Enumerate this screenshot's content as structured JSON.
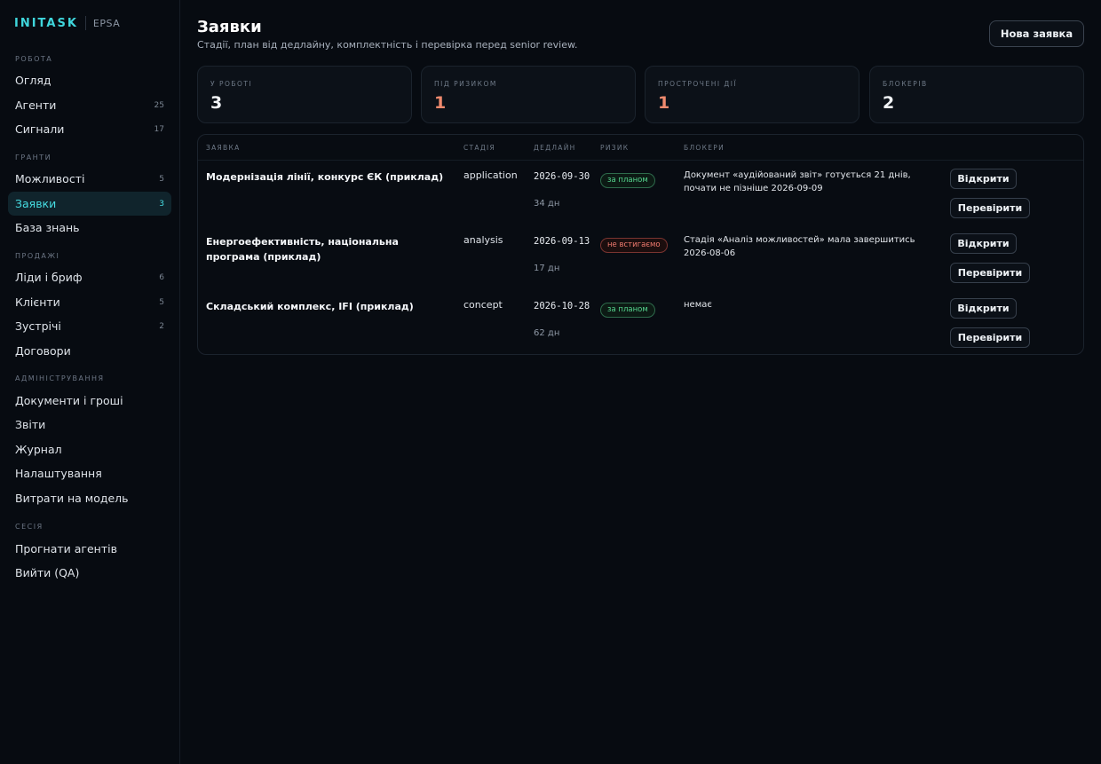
{
  "brand": {
    "logo": "INITASK",
    "sub": "EPSA"
  },
  "sidebar": {
    "sections": [
      {
        "title": "РОБОТА",
        "items": [
          {
            "label": "Огляд",
            "count": ""
          },
          {
            "label": "Агенти",
            "count": "25"
          },
          {
            "label": "Сигнали",
            "count": "17"
          }
        ]
      },
      {
        "title": "ГРАНТИ",
        "items": [
          {
            "label": "Можливості",
            "count": "5"
          },
          {
            "label": "Заявки",
            "count": "3",
            "active": true
          },
          {
            "label": "База знань",
            "count": ""
          }
        ]
      },
      {
        "title": "ПРОДАЖІ",
        "items": [
          {
            "label": "Ліди і бриф",
            "count": "6"
          },
          {
            "label": "Клієнти",
            "count": "5"
          },
          {
            "label": "Зустрічі",
            "count": "2"
          },
          {
            "label": "Договори",
            "count": ""
          }
        ]
      },
      {
        "title": "АДМІНІСТРУВАННЯ",
        "items": [
          {
            "label": "Документи і гроші",
            "count": ""
          },
          {
            "label": "Звіти",
            "count": ""
          },
          {
            "label": "Журнал",
            "count": ""
          },
          {
            "label": "Налаштування",
            "count": ""
          },
          {
            "label": "Витрати на модель",
            "count": ""
          }
        ]
      },
      {
        "title": "СЕСІЯ",
        "items": [
          {
            "label": "Прогнати агентів",
            "count": ""
          },
          {
            "label": "Вийти (QA)",
            "count": ""
          }
        ]
      }
    ]
  },
  "header": {
    "title": "Заявки",
    "subtitle": "Стадії, план від дедлайну, комплектність і перевірка перед senior review.",
    "new_button": "Нова заявка"
  },
  "stats": [
    {
      "label": "У РОБОТІ",
      "value": "3",
      "warn": false
    },
    {
      "label": "ПІД РИЗИКОМ",
      "value": "1",
      "warn": true
    },
    {
      "label": "ПРОСТРОЧЕНІ ДІЇ",
      "value": "1",
      "warn": true
    },
    {
      "label": "БЛОКЕРІВ",
      "value": "2",
      "warn": false
    }
  ],
  "table": {
    "columns": {
      "name": "ЗАЯВКА",
      "stage": "СТАДІЯ",
      "deadline": "ДЕДЛАЙН",
      "risk": "РИЗИК",
      "blockers": "БЛОКЕРИ"
    },
    "rows": [
      {
        "name": "Модернізація лінії, конкурс ЄК (приклад)",
        "stage": "application",
        "deadline": "2026-09-30",
        "days": "34 дн",
        "risk": "за планом",
        "risk_status": "ok",
        "blockers": "Документ «аудійований звіт» готується 21 днів, почати не пізніше 2026-09-09",
        "open": "Відкрити",
        "check": "Перевірити"
      },
      {
        "name": "Енергоефективність, національна програма (приклад)",
        "stage": "analysis",
        "deadline": "2026-09-13",
        "days": "17 дн",
        "risk": "не встигаємо",
        "risk_status": "bad",
        "blockers": "Стадія «Аналіз можливостей» мала завершитись 2026-08-06",
        "open": "Відкрити",
        "check": "Перевірити"
      },
      {
        "name": "Складський комплекс, IFI (приклад)",
        "stage": "concept",
        "deadline": "2026-10-28",
        "days": "62 дн",
        "risk": "за планом",
        "risk_status": "ok",
        "blockers": "немає",
        "open": "Відкрити",
        "check": "Перевірити"
      }
    ]
  }
}
